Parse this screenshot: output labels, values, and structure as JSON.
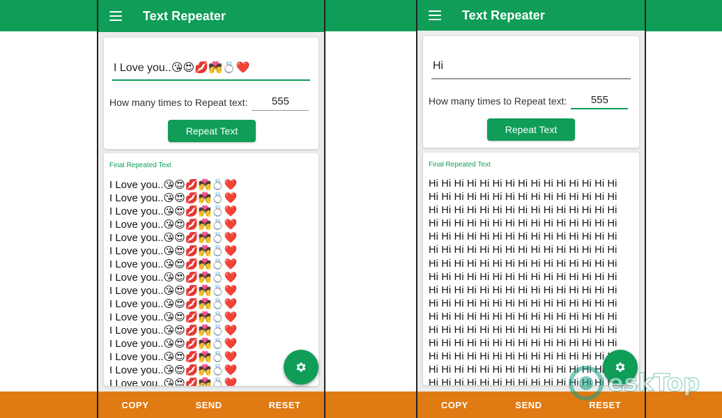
{
  "colors": {
    "primary_green": "#0f9d58",
    "bottom_bar_orange": "#e07a12",
    "card_background": "#ffffff"
  },
  "left_screen": {
    "app_title": "Text Repeater",
    "input_text": "I Love you..😘😍💋💏💍❤️",
    "repeat_label": "How many times to Repeat text:",
    "repeat_count": "555",
    "repeat_button": "Repeat Text",
    "result_title": "Final Repeated Text",
    "result_lines": [
      "I Love you..😘😍💋💏💍❤️",
      "I Love you..😘😍💋💏💍❤️",
      "I Love you..😘😍💋💏💍❤️",
      "I Love you..😘😍💋💏💍❤️",
      "I Love you..😘😍💋💏💍❤️",
      "I Love you..😘😍💋💏💍❤️",
      "I Love you..😘😍💋💏💍❤️",
      "I Love you..😘😍💋💏💍❤️",
      "I Love you..😘😍💋💏💍❤️",
      "I Love you..😘😍💋💏💍❤️",
      "I Love you..😘😍💋💏💍❤️",
      "I Love you..😘😍💋💏💍❤️",
      "I Love you..😘😍💋💏💍❤️",
      "I Love you..😘😍💋💏💍❤️",
      "I Love you..😘😍💋💏💍❤️",
      "I Love you..😘😍💋💏💍❤️"
    ],
    "fab_icon": "gear-icon",
    "bottom_buttons": {
      "copy": "COPY",
      "send": "SEND",
      "reset": "RESET"
    }
  },
  "right_screen": {
    "app_title": "Text Repeater",
    "input_text": "Hi",
    "repeat_label": "How many times to Repeat text:",
    "repeat_count": "555",
    "repeat_button": "Repeat Text",
    "result_title": "Final Repeated Text",
    "result_lines": [
      "Hi Hi Hi Hi Hi Hi Hi Hi Hi Hi Hi Hi Hi Hi Hi",
      "Hi Hi Hi Hi Hi Hi Hi Hi Hi Hi Hi Hi Hi Hi Hi",
      "Hi Hi Hi Hi Hi Hi Hi Hi Hi Hi Hi Hi Hi Hi Hi",
      "Hi Hi Hi Hi Hi Hi Hi Hi Hi Hi Hi Hi Hi Hi Hi",
      "Hi Hi Hi Hi Hi Hi Hi Hi Hi Hi Hi Hi Hi Hi Hi",
      "Hi Hi Hi Hi Hi Hi Hi Hi Hi Hi Hi Hi Hi Hi Hi",
      "Hi Hi Hi Hi Hi Hi Hi Hi Hi Hi Hi Hi Hi Hi Hi",
      "Hi Hi Hi Hi Hi Hi Hi Hi Hi Hi Hi Hi Hi Hi Hi",
      "Hi Hi Hi Hi Hi Hi Hi Hi Hi Hi Hi Hi Hi Hi Hi",
      "Hi Hi Hi Hi Hi Hi Hi Hi Hi Hi Hi Hi Hi Hi Hi",
      "Hi Hi Hi Hi Hi Hi Hi Hi Hi Hi Hi Hi Hi Hi Hi",
      "Hi Hi Hi Hi Hi Hi Hi Hi Hi Hi Hi Hi Hi Hi Hi",
      "Hi Hi Hi Hi Hi Hi Hi Hi Hi Hi Hi Hi Hi Hi Hi",
      "Hi Hi Hi Hi Hi Hi Hi Hi Hi Hi Hi Hi Hi Hi Hi",
      "Hi Hi Hi Hi Hi Hi Hi Hi Hi Hi Hi Hi Hi Hi Hi",
      "Hi Hi Hi Hi Hi Hi Hi Hi Hi Hi Hi Hi Hi Hi Hi"
    ],
    "fab_icon": "gear-icon",
    "bottom_buttons": {
      "copy": "COPY",
      "send": "SEND",
      "reset": "RESET"
    }
  },
  "watermark": {
    "text": "eskTop",
    "icon": "desktop-logo-icon"
  }
}
